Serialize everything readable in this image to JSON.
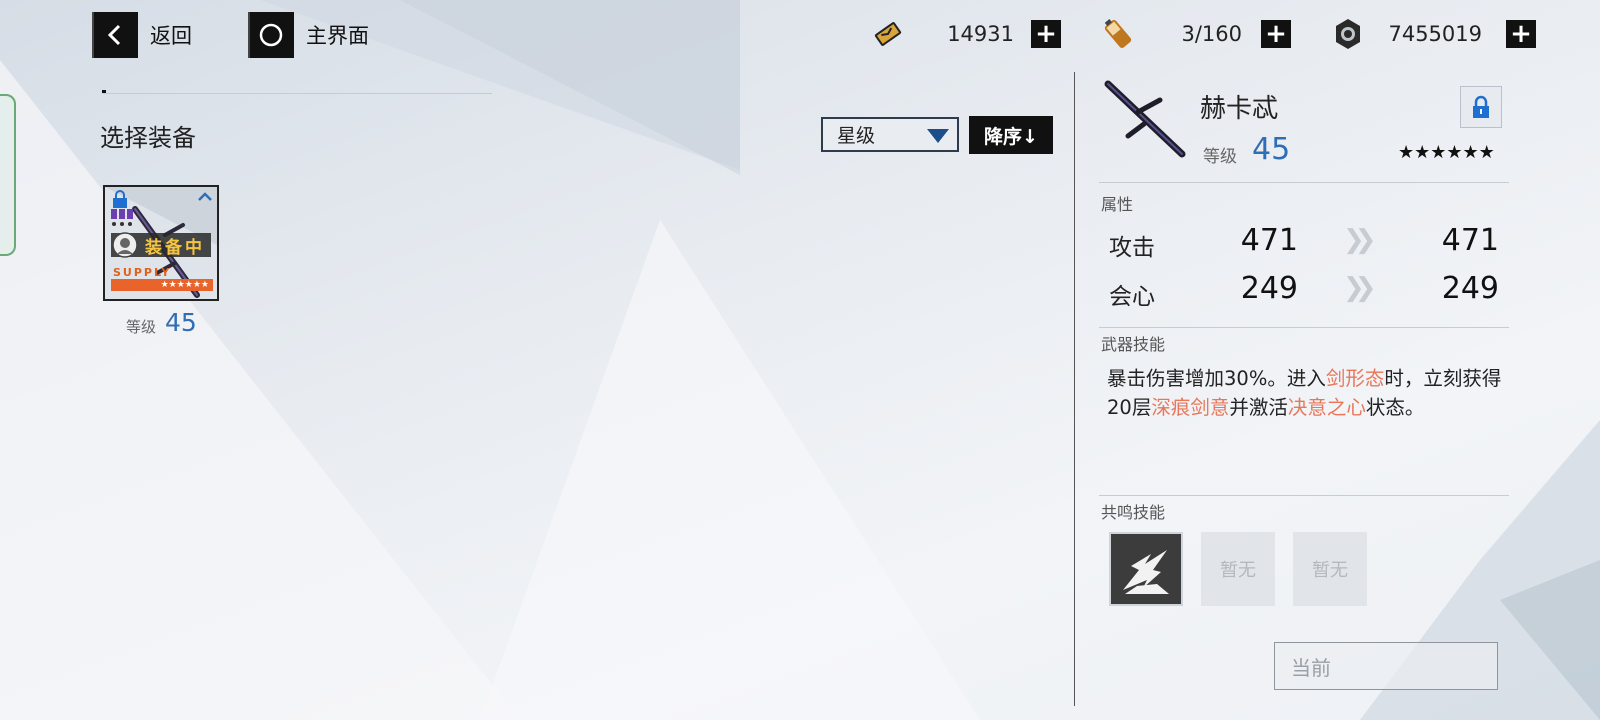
{
  "header": {
    "back_label": "返回",
    "home_label": "主界面"
  },
  "currencies": [
    {
      "icon": "gold-ticket-icon",
      "value": "14931"
    },
    {
      "icon": "battery-icon",
      "value": "3/160"
    },
    {
      "icon": "gear-coin-icon",
      "value": "7455019"
    }
  ],
  "left_panel": {
    "title": "选择装备",
    "sort_label": "星级",
    "order_label": "降序↓",
    "items": [
      {
        "status": "装备中",
        "brand": "SUPPLY",
        "stars": "★★★★★★",
        "level_label": "等级",
        "level": "45"
      }
    ]
  },
  "detail": {
    "name": "赫卡忒",
    "level_label": "等级",
    "level": "45",
    "stars": "★★★★★★",
    "attributes_label": "属性",
    "stats": [
      {
        "name": "攻击",
        "current": "471",
        "next": "471"
      },
      {
        "name": "会心",
        "current": "249",
        "next": "249"
      }
    ],
    "weapon_skill_label": "武器技能",
    "skill_text": {
      "p1": "暴击伤害增加30%。进入",
      "h1": "剑形态",
      "p2": "时，立刻获得20层",
      "h2": "深痕剑意",
      "p3": "并激活",
      "h3": "决意之心",
      "p4": "状态。"
    },
    "resonance_label": "共鸣技能",
    "resonance_slots": [
      "",
      "暂无",
      "暂无"
    ],
    "current_button": "当前"
  },
  "colors": {
    "accent_blue": "#2f6db5",
    "highlight": "#e8775a",
    "equipped_yellow": "#f5c542",
    "supply_orange": "#e8642a"
  }
}
